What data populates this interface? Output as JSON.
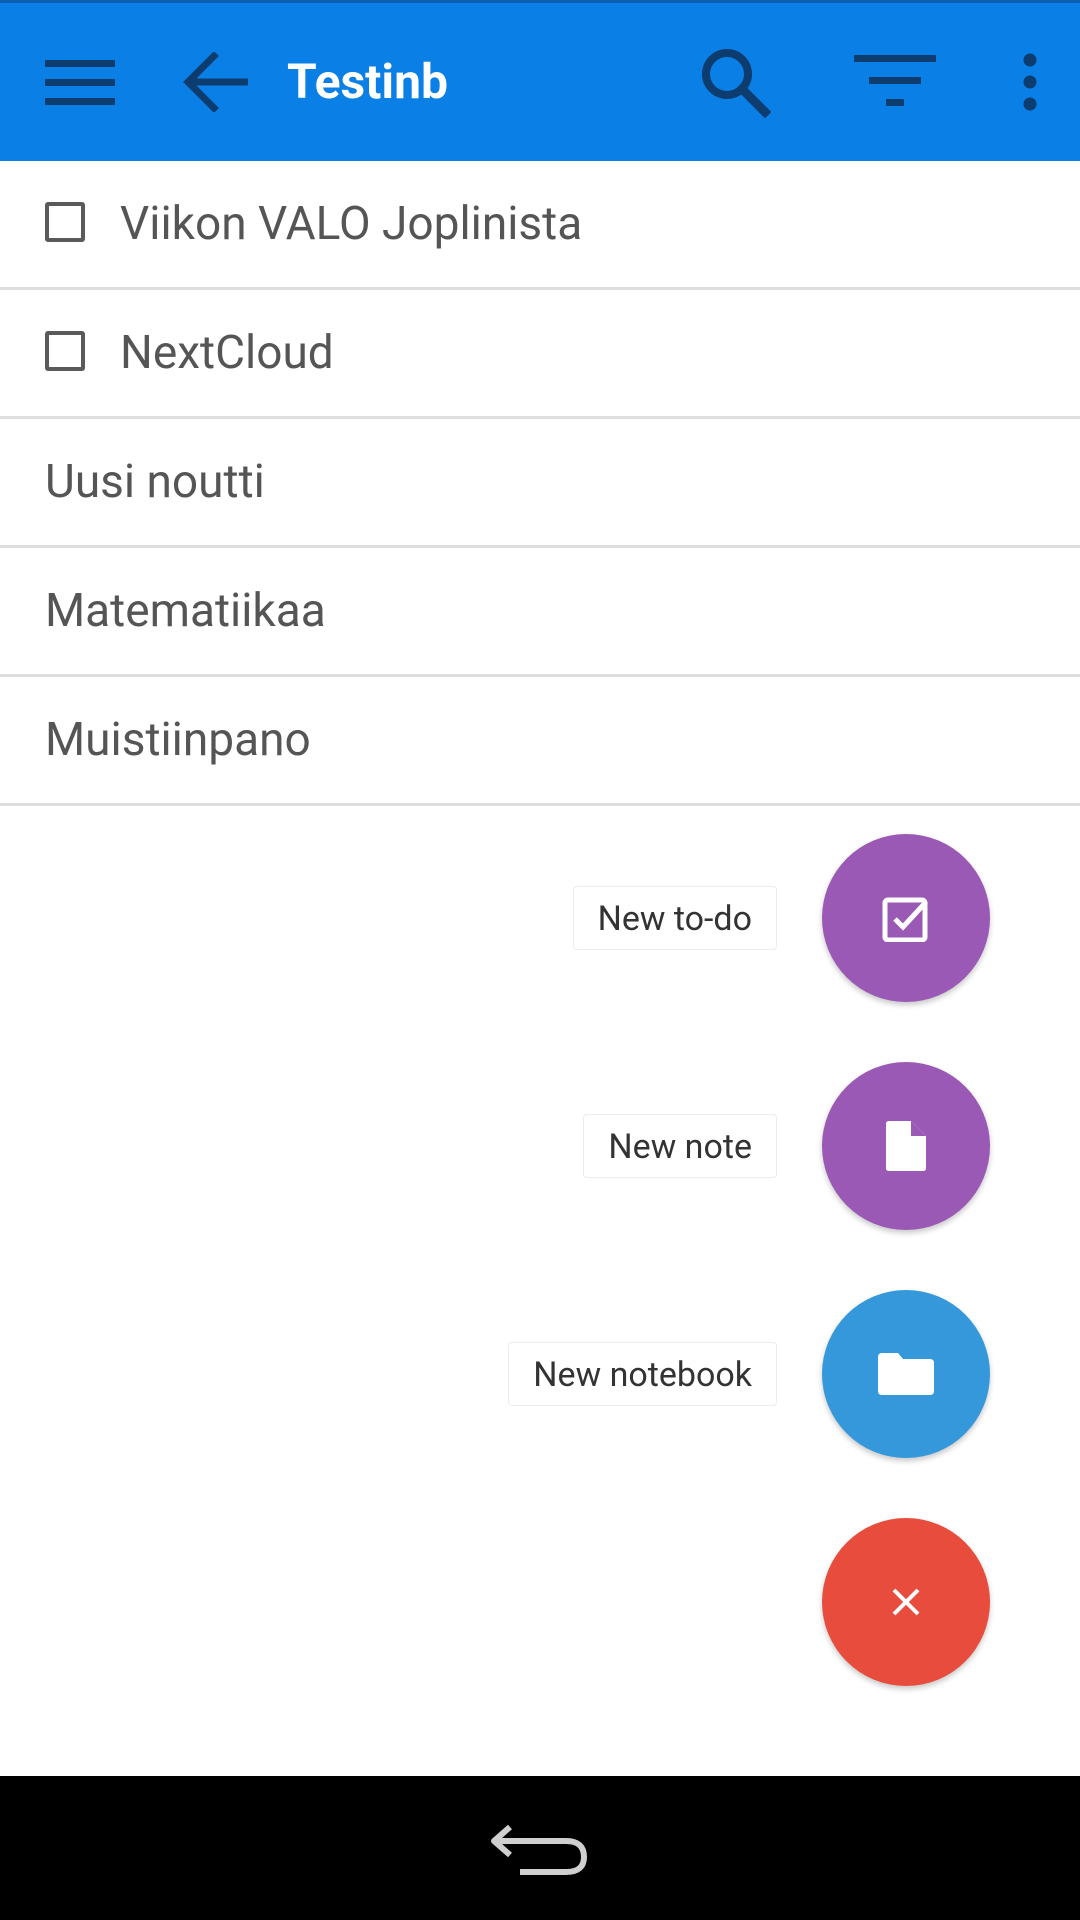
{
  "appbar": {
    "title": "Testinb",
    "background_color": "#0a7fe6",
    "icons": {
      "menu": "menu-icon",
      "back": "arrow-back-icon",
      "search": "search-icon",
      "filter": "filter-icon",
      "overflow": "more-vert-icon"
    }
  },
  "notes": [
    {
      "title": "Viikon VALO Joplinista",
      "is_todo": true,
      "checked": false
    },
    {
      "title": "NextCloud",
      "is_todo": true,
      "checked": false
    },
    {
      "title": "Uusi noutti",
      "is_todo": false
    },
    {
      "title": "Matematiikaa",
      "is_todo": false
    },
    {
      "title": "Muistiinpano",
      "is_todo": false
    }
  ],
  "fab_menu": {
    "new_todo": {
      "label": "New to-do",
      "color": "#9b59b6",
      "icon": "checkbox-icon"
    },
    "new_note": {
      "label": "New note",
      "color": "#9b59b6",
      "icon": "document-icon"
    },
    "new_notebook": {
      "label": "New notebook",
      "color": "#3498db",
      "icon": "folder-icon"
    },
    "close": {
      "color": "#e74c3c",
      "icon": "close-icon"
    }
  },
  "system_nav": {
    "back_icon": "system-back-icon"
  }
}
